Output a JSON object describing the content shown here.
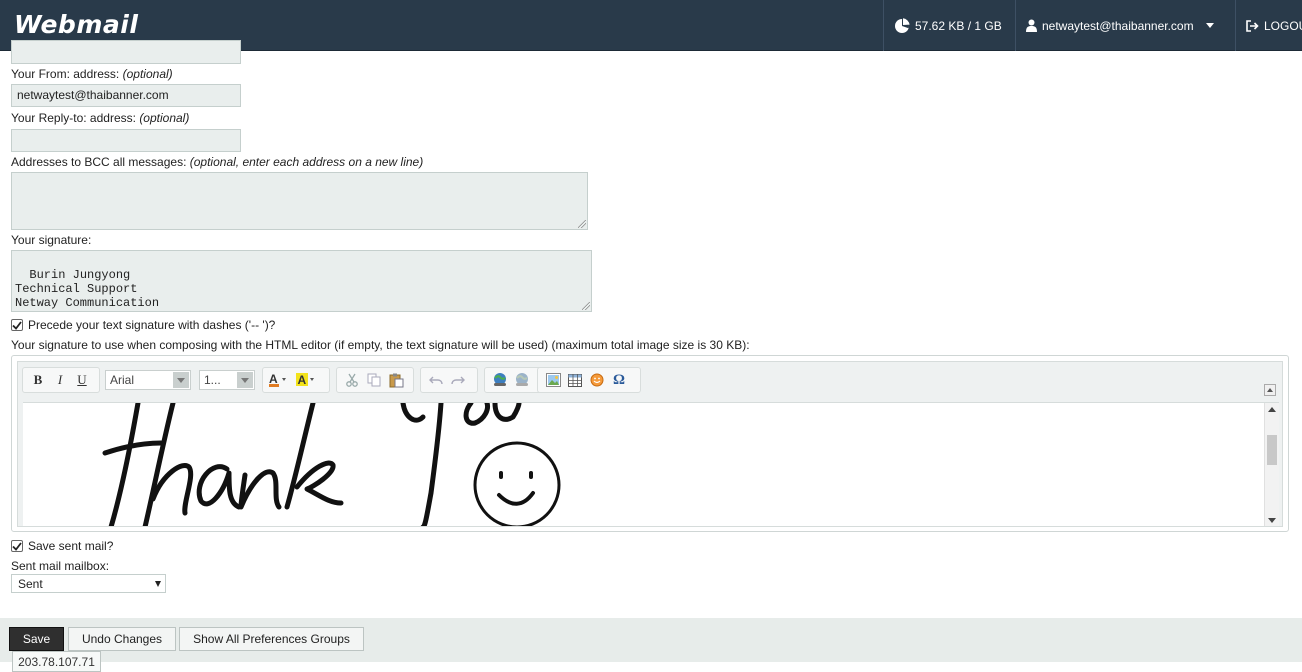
{
  "header": {
    "logo": "Webmail",
    "quota": "57.62 KB / 1 GB",
    "user": "netwaytest@thaibanner.com",
    "logout": "LOGOUT"
  },
  "form": {
    "from_label": "Your From: address:",
    "from_optional": "(optional)",
    "from_value": "netwaytest@thaibanner.com",
    "replyto_label": "Your Reply-to: address:",
    "replyto_optional": "(optional)",
    "replyto_value": "",
    "bcc_label": "Addresses to BCC all messages:",
    "bcc_optional": "(optional, enter each address on a new line)",
    "bcc_value": "",
    "signature_label": "Your signature:",
    "signature_value": "Burin Jungyong\nTechnical Support\nNetway Communication",
    "dashes_label": "Precede your text signature with dashes ('-- ')?",
    "dashes_checked": true,
    "html_sig_label": "Your signature to use when composing with the HTML editor (if empty, the text signature will be used) (maximum total image size is 30 KB):",
    "save_sent_label": "Save sent mail?",
    "save_sent_checked": true,
    "sent_mailbox_label": "Sent mail mailbox:",
    "sent_mailbox_value": "Sent"
  },
  "editor": {
    "font_value": "Arial",
    "size_value": "1...",
    "bold_label": "B",
    "italic_label": "I",
    "underline_label": "U",
    "omega_label": "Ω"
  },
  "footer": {
    "save_label": "Save",
    "undo_label": "Undo Changes",
    "show_all_label": "Show All Preferences Groups"
  },
  "ip": "203.78.107.71",
  "colors": {
    "header_bg": "#293a4a",
    "field_bg": "#e9eeed",
    "footer_bg": "#e7ecea"
  }
}
